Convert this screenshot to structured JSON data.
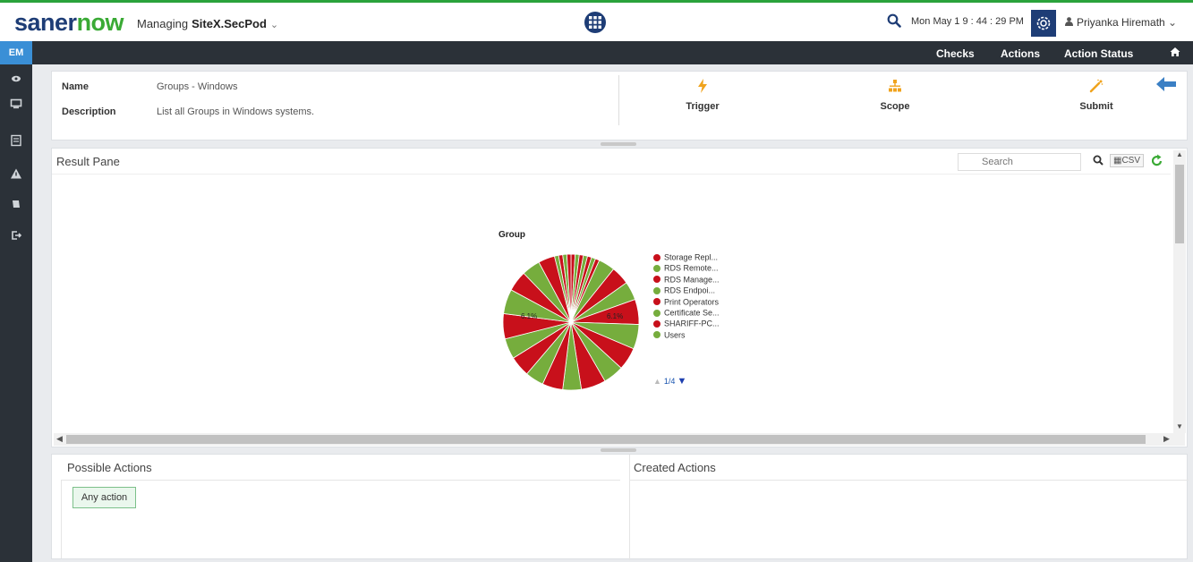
{
  "header": {
    "brand_a": "saner",
    "brand_b": "now",
    "managing_label": "Managing",
    "site": "SiteX.SecPod",
    "datetime": "Mon May 1  9 : 44 : 29 PM",
    "user_name": "Priyanka Hiremath"
  },
  "nav": {
    "items": [
      "Checks",
      "Actions",
      "Action Status"
    ]
  },
  "sidebar": {
    "active": "EM",
    "icons": [
      "eye-icon",
      "monitor-icon",
      "list-icon",
      "alert-icon",
      "tag-icon",
      "logout-icon"
    ]
  },
  "details": {
    "name_label": "Name",
    "name_value": "Groups - Windows",
    "description_label": "Description",
    "description_value": "List all Groups in Windows systems.",
    "tools": [
      "Trigger",
      "Scope",
      "Submit"
    ]
  },
  "result_pane": {
    "title": "Result Pane",
    "search_placeholder": "Search",
    "csv_label": "CSV",
    "pager": "1/4",
    "slice_labels": [
      "6.1%",
      "6.1%"
    ]
  },
  "colors": {
    "green": "#76ad3d",
    "red": "#c8101b",
    "brand_blue": "#1e3d76",
    "brand_green": "#3aaa35",
    "accent_blue": "#3a8fd6"
  },
  "chart_data": {
    "type": "pie",
    "title": "Group",
    "legend": [
      {
        "label": "Storage Repl...",
        "color": "#c8101b"
      },
      {
        "label": "RDS Remote...",
        "color": "#76ad3d"
      },
      {
        "label": "RDS Manage...",
        "color": "#c8101b"
      },
      {
        "label": "RDS Endpoi...",
        "color": "#76ad3d"
      },
      {
        "label": "Print Operators",
        "color": "#c8101b"
      },
      {
        "label": "Certificate Se...",
        "color": "#76ad3d"
      },
      {
        "label": "SHARIFF-PC...",
        "color": "#c8101b"
      },
      {
        "label": "Users",
        "color": "#76ad3d"
      }
    ],
    "slices": [
      {
        "value": 1.0,
        "color": "#c8101b"
      },
      {
        "value": 1.0,
        "color": "#76ad3d"
      },
      {
        "value": 1.0,
        "color": "#c8101b"
      },
      {
        "value": 1.0,
        "color": "#76ad3d"
      },
      {
        "value": 1.0,
        "color": "#c8101b"
      },
      {
        "value": 1.0,
        "color": "#76ad3d"
      },
      {
        "value": 1.0,
        "color": "#c8101b"
      },
      {
        "value": 4.0,
        "color": "#76ad3d"
      },
      {
        "value": 4.5,
        "color": "#c8101b"
      },
      {
        "value": 4.5,
        "color": "#76ad3d"
      },
      {
        "value": 6.1,
        "color": "#c8101b"
      },
      {
        "value": 6.0,
        "color": "#76ad3d"
      },
      {
        "value": 5.5,
        "color": "#c8101b"
      },
      {
        "value": 5.0,
        "color": "#76ad3d"
      },
      {
        "value": 6.0,
        "color": "#c8101b"
      },
      {
        "value": 4.5,
        "color": "#76ad3d"
      },
      {
        "value": 5.0,
        "color": "#c8101b"
      },
      {
        "value": 4.5,
        "color": "#76ad3d"
      },
      {
        "value": 5.0,
        "color": "#c8101b"
      },
      {
        "value": 5.0,
        "color": "#76ad3d"
      },
      {
        "value": 6.1,
        "color": "#c8101b"
      },
      {
        "value": 6.0,
        "color": "#76ad3d"
      },
      {
        "value": 5.0,
        "color": "#c8101b"
      },
      {
        "value": 4.5,
        "color": "#76ad3d"
      },
      {
        "value": 4.0,
        "color": "#c8101b"
      },
      {
        "value": 1.0,
        "color": "#76ad3d"
      },
      {
        "value": 1.0,
        "color": "#c8101b"
      },
      {
        "value": 1.0,
        "color": "#76ad3d"
      },
      {
        "value": 1.0,
        "color": "#c8101b"
      }
    ]
  },
  "bottom": {
    "possible_title": "Possible Actions",
    "created_title": "Created Actions",
    "any_action": "Any action"
  }
}
